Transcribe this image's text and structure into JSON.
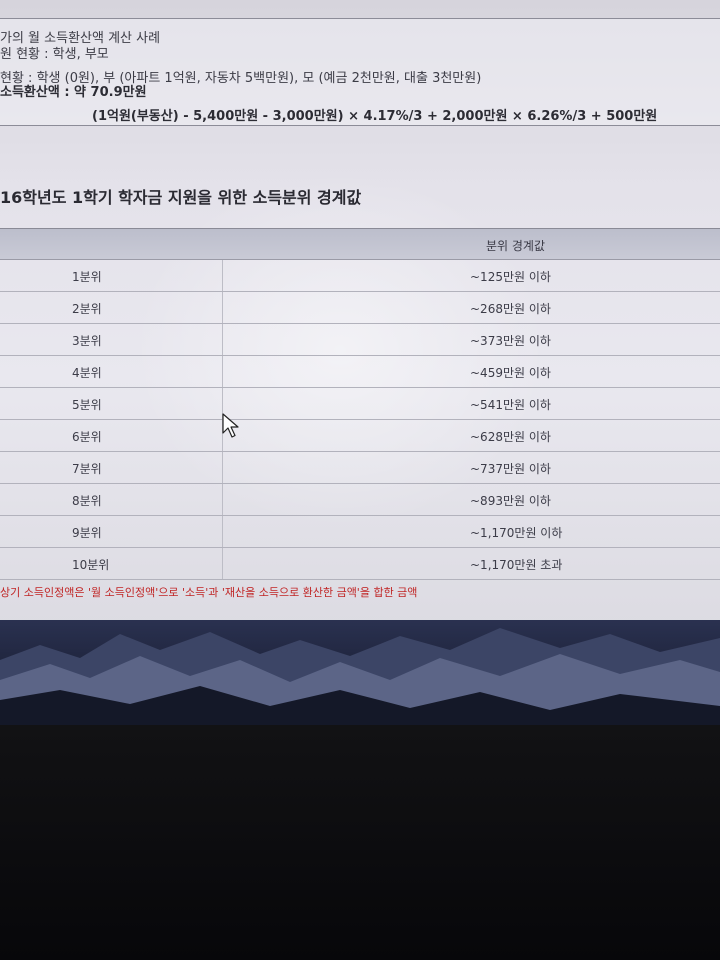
{
  "example": {
    "line1": "가의 월 소득환산액 계산 사례",
    "line2": "원 현황 : 학생, 부모",
    "line3": "현황 : 학생 (0원), 부 (아파트 1억원, 자동차 5백만원), 모 (예금 2천만원, 대출 3천만원)",
    "line4": "소득환산액 : 약 70.9만원",
    "line5": "(1억원(부동산) - 5,400만원 - 3,000만원) × 4.17%/3 + 2,000만원 × 6.26%/3 + 500만원"
  },
  "section_title": "16학년도 1학기 학자금 지원을 위한 소득분위 경계값",
  "table": {
    "header_col2": "분위 경계값",
    "rows": [
      {
        "rank": "1분위",
        "value": "~125만원 이하"
      },
      {
        "rank": "2분위",
        "value": "~268만원 이하"
      },
      {
        "rank": "3분위",
        "value": "~373만원 이하"
      },
      {
        "rank": "4분위",
        "value": "~459만원 이하"
      },
      {
        "rank": "5분위",
        "value": "~541만원 이하"
      },
      {
        "rank": "6분위",
        "value": "~628만원 이하"
      },
      {
        "rank": "7분위",
        "value": "~737만원 이하"
      },
      {
        "rank": "8분위",
        "value": "~893만원 이하"
      },
      {
        "rank": "9분위",
        "value": "~1,170만원 이하"
      },
      {
        "rank": "10분위",
        "value": "~1,170만원 초과"
      }
    ]
  },
  "note": "상기 소득인정액은 '월 소득인정액'으로 '소득'과 '재산을 소득으로 환산한 금액'을 합한 금액",
  "colors": {
    "note": "#c02424",
    "header_bg": "#c0c2cf"
  },
  "icons": {
    "cursor": "mouse-pointer-icon"
  }
}
